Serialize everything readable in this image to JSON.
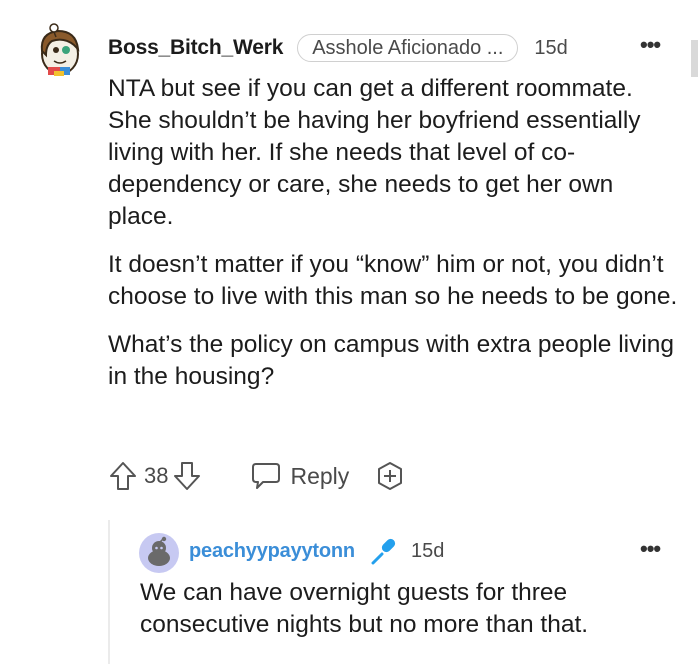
{
  "comment": {
    "username": "Boss_Bitch_Werk",
    "flair": "Asshole Aficionado ...",
    "age": "15d",
    "more": "•••",
    "paragraphs": [
      "NTA but see if you can get a different roommate. She shouldn’t be having her boyfriend essentially living with her. If she needs that level of co-dependency or care, she needs to get her own place.",
      "It doesn’t matter if you “know” him or not, you didn’t choose to live with this man so he needs to be gone.",
      "What’s the policy on campus with extra people living in the housing?"
    ],
    "score": "38",
    "reply_label": "Reply",
    "icons": [
      "snoo-avatar-icon",
      "upvote-icon",
      "downvote-icon",
      "reply-bubble-icon",
      "award-plus-icon",
      "more-dots-icon"
    ]
  },
  "reply": {
    "username": "peachyypayytonn",
    "age": "15d",
    "more": "•••",
    "text": "We can have overnight guests for three consecutive nights but no more than that.",
    "icons": [
      "default-snoo-avatar-icon",
      "microphone-icon",
      "more-dots-icon"
    ]
  },
  "colors": {
    "text": "#1c1c1c",
    "meta": "#4a4a4a",
    "username_link": "#3b8ed8",
    "mic": "#24a0ed",
    "thread_line": "#ebebeb"
  }
}
